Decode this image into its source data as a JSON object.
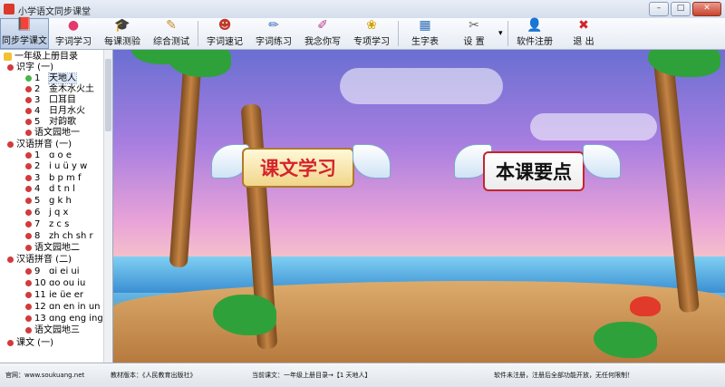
{
  "window": {
    "title": "小学语文同步课堂",
    "buttons": {
      "minimize": "–",
      "maximize": "□",
      "close": "✕"
    }
  },
  "toolbar": {
    "items": [
      {
        "label": "同步学课文",
        "icon": "book-icon",
        "glyph": "📕"
      },
      {
        "label": "字词学习",
        "icon": "balls-icon",
        "glyph": "●"
      },
      {
        "label": "每课测验",
        "icon": "graduation-cap-icon",
        "glyph": "🎓"
      },
      {
        "label": "综合测试",
        "icon": "notebook-icon",
        "glyph": "✎"
      },
      {
        "label": "字词速记",
        "icon": "character-mascot-icon",
        "glyph": "☻"
      },
      {
        "label": "字词练习",
        "icon": "pencil-icon",
        "glyph": "✏"
      },
      {
        "label": "我念你写",
        "icon": "pens-icon",
        "glyph": "✐"
      },
      {
        "label": "专项学习",
        "icon": "bee-icon",
        "glyph": "❀"
      },
      {
        "label": "生字表",
        "icon": "table-icon",
        "glyph": "▦"
      },
      {
        "label": "设 置",
        "icon": "settings-icon",
        "glyph": "✂"
      },
      {
        "label": "软件注册",
        "icon": "user-icon",
        "glyph": "👤"
      },
      {
        "label": "退 出",
        "icon": "exit-icon",
        "glyph": "✖"
      }
    ],
    "dropdown_arrow": "▾"
  },
  "tree": {
    "root": "一年级上册目录",
    "groups": [
      {
        "label": "识字 (一)",
        "items": [
          {
            "num": "1",
            "text": "天地人"
          },
          {
            "num": "2",
            "text": "金木水火土"
          },
          {
            "num": "3",
            "text": "口耳目"
          },
          {
            "num": "4",
            "text": "日月水火"
          },
          {
            "num": "5",
            "text": "对韵歌"
          },
          {
            "num": "",
            "text": "语文园地一"
          }
        ]
      },
      {
        "label": "汉语拼音 (一)",
        "items": [
          {
            "num": "1",
            "text": "ɑ o e"
          },
          {
            "num": "2",
            "text": "i u ü y w"
          },
          {
            "num": "3",
            "text": "b p m f"
          },
          {
            "num": "4",
            "text": "d t n l"
          },
          {
            "num": "5",
            "text": "g k h"
          },
          {
            "num": "6",
            "text": "j q x"
          },
          {
            "num": "7",
            "text": "z c s"
          },
          {
            "num": "8",
            "text": "zh ch sh r"
          },
          {
            "num": "",
            "text": "语文园地二"
          }
        ]
      },
      {
        "label": "汉语拼音 (二)",
        "items": [
          {
            "num": "9",
            "text": "ɑi ei ui"
          },
          {
            "num": "10",
            "text": "ɑo ou iu"
          },
          {
            "num": "11",
            "text": "ie üe er"
          },
          {
            "num": "12",
            "text": "ɑn en in un ün"
          },
          {
            "num": "13",
            "text": "ɑng eng ing ong"
          },
          {
            "num": "",
            "text": "语文园地三"
          }
        ]
      },
      {
        "label": "课文 (一)",
        "items": []
      }
    ]
  },
  "scene": {
    "banner_left": "课文学习",
    "banner_right": "本课要点"
  },
  "status": {
    "website": "官网：www.soukuang.net",
    "edition": "教材版本：《人民教育出版社》",
    "current": "当前课文：一年级上册目录→【1   天地人】",
    "register": "软件未注册，注册后全部功能开放，无任何限制！"
  }
}
